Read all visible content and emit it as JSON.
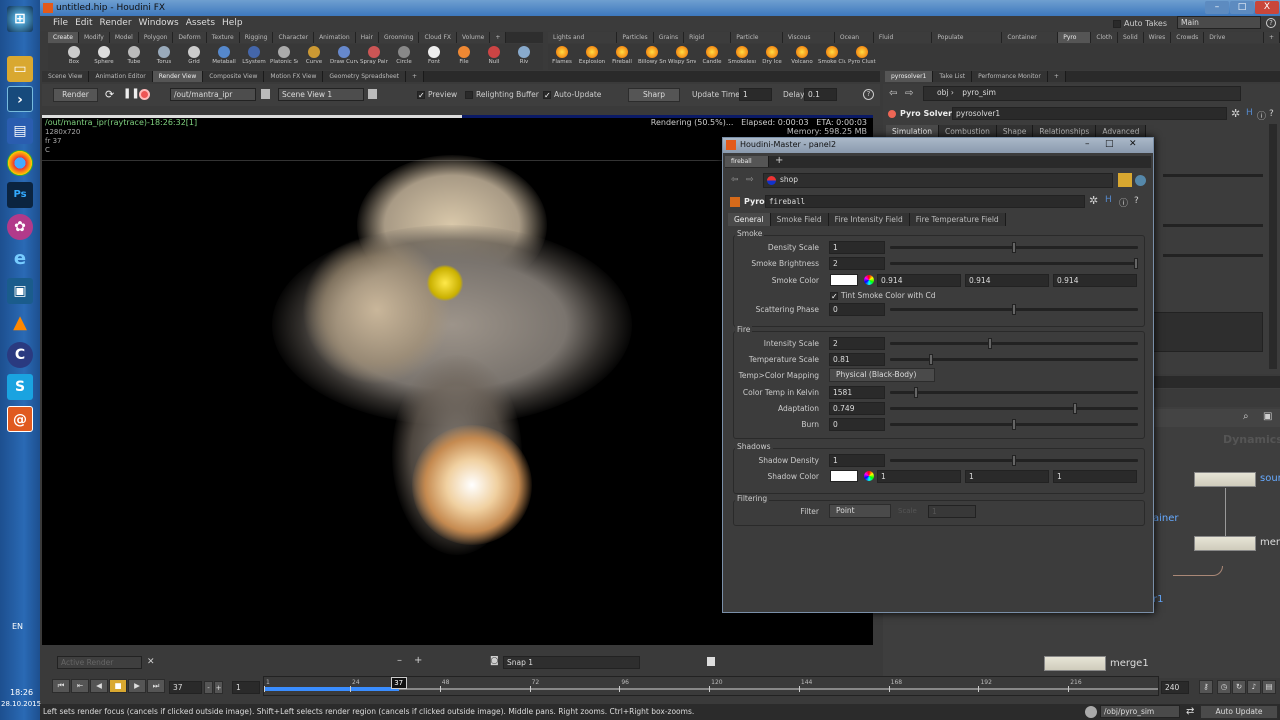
{
  "window": {
    "title": "untitled.hip - Houdini FX",
    "minimize": "–",
    "maximize": "□",
    "close": "X"
  },
  "taskbar": {
    "language": "EN",
    "time": "18:26",
    "date": "28.10.2015"
  },
  "menu": [
    "File",
    "Edit",
    "Render",
    "Windows",
    "Assets",
    "Help"
  ],
  "top_right": {
    "auto_takes": "Auto Takes",
    "desktop": "Main",
    "help": "?"
  },
  "shelf_left": {
    "tabs": [
      "Create",
      "Modify",
      "Model",
      "Polygon",
      "Deform",
      "Texture",
      "Rigging",
      "Character",
      "Animation",
      "Hair",
      "Grooming",
      "Cloud FX",
      "Volume",
      "+"
    ],
    "tools": [
      "Box",
      "Sphere",
      "Tube",
      "Torus",
      "Grid",
      "Metaball",
      "LSystem",
      "Platonic Sol...",
      "Curve",
      "Draw Curve",
      "Spray Paint",
      "Circle",
      "Font",
      "File",
      "Null",
      "Riv"
    ]
  },
  "shelf_right": {
    "tabs": [
      "Lights and Cameras",
      "Particles",
      "Grains",
      "Rigid Bodies",
      "Particle Fluids",
      "Viscous Fluids",
      "Ocean FX",
      "Fluid Containers",
      "Populate Containers",
      "Container Tools",
      "Pyro FX",
      "Cloth",
      "Solid",
      "Wires",
      "Crowds",
      "Drive Simulation",
      "+"
    ],
    "tools": [
      "Flames",
      "Explosion",
      "Fireball",
      "Billowy Sm...",
      "Wispy Smoke",
      "Candle",
      "Smokeless...",
      "Dry Ice",
      "Volcano",
      "Smoke Clus...",
      "Pyro Cluster"
    ]
  },
  "pane_tabs_left": [
    "Scene View",
    "Animation Editor",
    "Render View",
    "Composite View",
    "Motion FX View",
    "Geometry Spreadsheet",
    "+"
  ],
  "pane_tabs_right": [
    "pyrosolver1",
    "Take List",
    "Performance Monitor",
    "+"
  ],
  "render_toolbar": {
    "render": "Render",
    "rop": "/out/mantra_ipr",
    "camera": "Scene View 1",
    "preview": "Preview",
    "relighting": "Relighting Buffer",
    "auto_update": "Auto-Update",
    "mode": "Sharp",
    "update_time_label": "Update Time",
    "update_time": "1",
    "delay_label": "Delay",
    "delay": "0.1",
    "help": "?"
  },
  "render_info": {
    "name": "/out/mantra_ipr(raytrace)-18:26:32[1]",
    "resolution": "1280x720",
    "frame": "fr 37",
    "channel": "C",
    "status": "Rendering (50.5%)...",
    "elapsed": "Elapsed: 0:00:03",
    "eta": "ETA: 0:00:03",
    "memory": "Memory:   598.25 MB",
    "progress": 0.505
  },
  "right_panel": {
    "path_obj": "obj",
    "path_node": "pyro_sim",
    "node_type": "Pyro Solver",
    "node_name": "pyrosolver1",
    "tabs": [
      "Simulation",
      "Combustion",
      "Shape",
      "Relationships",
      "Advanced"
    ],
    "network_label": "Dynamics",
    "nodes": [
      {
        "label": "sour"
      },
      {
        "label": "mer"
      },
      {
        "label": "merge1"
      }
    ],
    "partial_labels": [
      "ainer",
      "r1"
    ]
  },
  "float_window": {
    "title": "Houdini-Master - panel2",
    "tab": "fireball",
    "path": "shop",
    "node_type": "Pyro",
    "node_name": "fireball",
    "tabs": [
      "General",
      "Smoke Field",
      "Fire Intensity Field",
      "Fire Temperature Field"
    ],
    "smoke": {
      "title": "Smoke",
      "density_scale": {
        "label": "Density Scale",
        "value": "1",
        "slider": 0.5
      },
      "smoke_brightness": {
        "label": "Smoke Brightness",
        "value": "2",
        "slider": 1.0
      },
      "smoke_color": {
        "label": "Smoke Color",
        "r": "0.914",
        "g": "0.914",
        "b": "0.914"
      },
      "tint": "Tint Smoke Color with Cd",
      "scattering_phase": {
        "label": "Scattering Phase",
        "value": "0",
        "slider": 0.5
      }
    },
    "fire": {
      "title": "Fire",
      "intensity_scale": {
        "label": "Intensity Scale",
        "value": "2",
        "slider": 0.4
      },
      "temperature_scale": {
        "label": "Temperature Scale",
        "value": "0.81",
        "slider": 0.16
      },
      "mapping": {
        "label": "Temp>Color Mapping",
        "value": "Physical (Black-Body)"
      },
      "color_temp": {
        "label": "Color Temp in Kelvin",
        "value": "1581",
        "slider": 0.1
      },
      "adaptation": {
        "label": "Adaptation",
        "value": "0.749",
        "slider": 0.75
      },
      "burn": {
        "label": "Burn",
        "value": "0",
        "slider": 0.5
      }
    },
    "shadows": {
      "title": "Shadows",
      "density": {
        "label": "Shadow Density",
        "value": "1",
        "slider": 0.5
      },
      "color": {
        "label": "Shadow Color",
        "r": "1",
        "g": "1",
        "b": "1"
      }
    },
    "filtering": {
      "title": "Filtering",
      "filter": {
        "label": "Filter",
        "value": "Point"
      },
      "scale_label": "Scale",
      "scale": "1"
    }
  },
  "bottom": {
    "active_render": "Active Render",
    "snap": "Snap  1",
    "minus": "–",
    "plus": "+"
  },
  "timeline": {
    "current_frame": "37",
    "step": "1",
    "start": 1,
    "end": 240,
    "end_field": "240",
    "ticks": [
      "1",
      "24",
      "48",
      "72",
      "96",
      "120",
      "144",
      "168",
      "192",
      "216"
    ],
    "cached_until": 37
  },
  "status": {
    "message": "Left sets render focus (cancels if clicked outside image). Shift+Left selects render region (cancels if clicked outside image). Middle pans. Right zooms. Ctrl+Right box-zooms.",
    "path": "/obj/pyro_sim",
    "update_mode": "Auto Update"
  },
  "colors": {
    "accent": "#3a8dff",
    "render_text": "#7fd17f",
    "taskbar": "#2a6ab5"
  }
}
